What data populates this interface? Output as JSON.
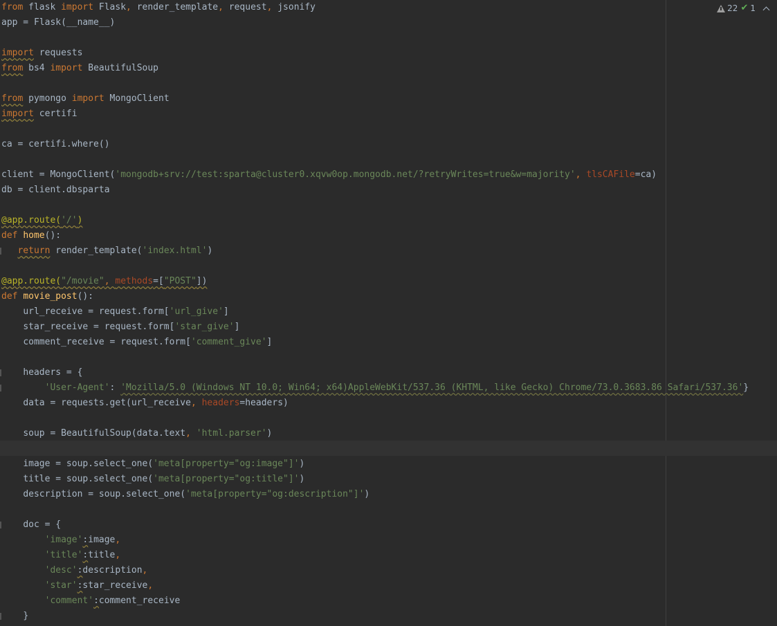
{
  "inspections": {
    "warnings_count": "22",
    "weak_warnings_count": "1"
  },
  "code": {
    "l1": {
      "a": "from",
      "b": " flask ",
      "c": "import",
      "d": " Flask",
      "e": ", ",
      "f": "render_template",
      "g": ", ",
      "h": "request",
      "i": ", ",
      "j": "jsonify"
    },
    "l2": {
      "a": "app = Flask(__name__)"
    },
    "l4": {
      "a": "import",
      "b": " requests"
    },
    "l5": {
      "a": "from",
      "b": " bs4 ",
      "c": "import",
      "d": " BeautifulSoup"
    },
    "l7": {
      "a": "from",
      "b": " pymongo ",
      "c": "import",
      "d": " MongoClient"
    },
    "l8": {
      "a": "import",
      "b": " certifi"
    },
    "l10": {
      "a": "ca = certifi.where()"
    },
    "l12": {
      "a": "client = MongoClient(",
      "b": "'mongodb+srv://test:sparta@cluster0.xqvw0op.mongodb.net/?retryWrites=true&w=majority'",
      "c": ", ",
      "d": "tlsCAFile",
      "e": "=ca)"
    },
    "l13": {
      "a": "db = client.dbsparta"
    },
    "l15": {
      "a": "@app.route(",
      "b": "'/'",
      "c": ")"
    },
    "l16": {
      "a": "def",
      "b": " ",
      "c": "home",
      "d": "():"
    },
    "l17": {
      "a": "return",
      "b": " render_template(",
      "c": "'index.html'",
      "d": ")"
    },
    "l19": {
      "a": "@app.route(",
      "b": "\"/movie\"",
      "c": ", ",
      "d": "methods",
      "e": "=[",
      "f": "\"POST\"",
      "g": "])"
    },
    "l20": {
      "a": "def",
      "b": " ",
      "c": "movie_post",
      "d": "():"
    },
    "l21": {
      "a": "url_receive = request.form[",
      "b": "'url_give'",
      "c": "]"
    },
    "l22": {
      "a": "star_receive = request.form[",
      "b": "'star_give'",
      "c": "]"
    },
    "l23": {
      "a": "comment_receive = request.form[",
      "b": "'comment_give'",
      "c": "]"
    },
    "l25": {
      "a": "headers = {"
    },
    "l26": {
      "a": "'User-Agent'",
      "b": ": ",
      "c": "'Mozilla/5.0 (Windows NT 10.0; Win64; x64)AppleWebKit/537.36 (KHTML, like Gecko) Chrome/73.0.3683.86 Safari/537.36'",
      "d": "}"
    },
    "l27": {
      "a": "data = requests.get(url_receive",
      "b": ", ",
      "c": "headers",
      "d": "=headers)"
    },
    "l29": {
      "a": "soup = BeautifulSoup(data.text",
      "b": ", ",
      "c": "'html.parser'",
      "d": ")"
    },
    "l31": {
      "a": "image = soup.select_one(",
      "b": "'meta[property=\"og:image\"]'",
      "c": ")"
    },
    "l32": {
      "a": "title = soup.select_one(",
      "b": "'meta[property=\"og:title\"]'",
      "c": ")"
    },
    "l33": {
      "a": "description = soup.select_one(",
      "b": "'meta[property=\"og:description\"]'",
      "c": ")"
    },
    "l35": {
      "a": "doc = {"
    },
    "l36": {
      "a": "'image'",
      "b": ":",
      "c": "image",
      "d": ","
    },
    "l37": {
      "a": "'title'",
      "b": ":",
      "c": "title",
      "d": ","
    },
    "l38": {
      "a": "'desc'",
      "b": ":",
      "c": "description",
      "d": ","
    },
    "l39": {
      "a": "'star'",
      "b": ":",
      "c": "star_receive",
      "d": ","
    },
    "l40": {
      "a": "'comment'",
      "b": ":",
      "c": "comment_receive"
    },
    "l41": {
      "a": "}"
    }
  }
}
